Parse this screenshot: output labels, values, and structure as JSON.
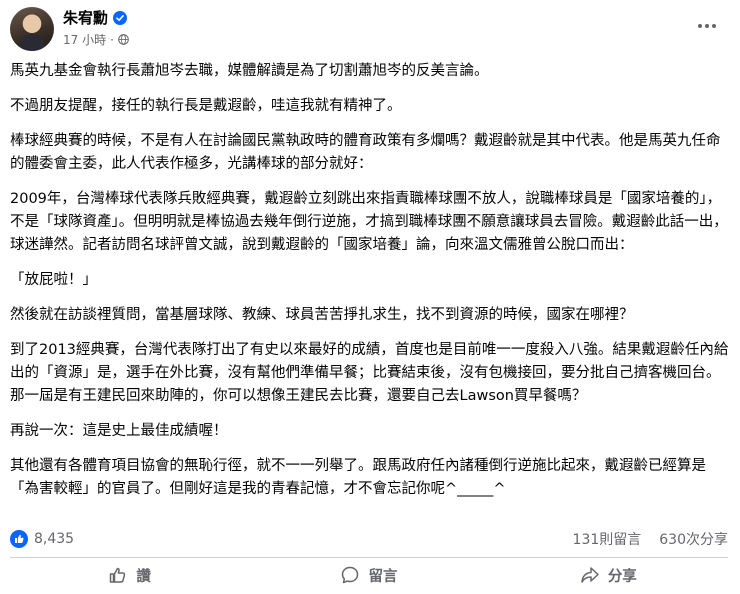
{
  "post": {
    "author": "朱宥勳",
    "time": "17 小時",
    "separator": "·",
    "paragraphs": [
      "馬英九基金會執行長蕭旭岑去職，媒體解讀是為了切割蕭旭岑的反美言論。",
      "不過朋友提醒，接任的執行長是戴遐齡，哇這我就有精神了。",
      "棒球經典賽的時候，不是有人在討論國民黨執政時的體育政策有多爛嗎？戴遐齡就是其中代表。他是馬英九任命的體委會主委，此人代表作極多，光講棒球的部分就好：",
      "2009年，台灣棒球代表隊兵敗經典賽，戴遐齡立刻跳出來指責職棒球團不放人，說職棒球員是「國家培養的」，不是「球隊資產」。但明明就是棒協過去幾年倒行逆施，才搞到職棒球團不願意讓球員去冒險。戴遐齡此話一出，球迷譁然。記者訪問名球評曾文誠，說到戴遐齡的「國家培養」論，向來溫文儒雅曾公脫口而出：",
      "「放屁啦！」",
      "然後就在訪談裡質問，當基層球隊、教練、球員苦苦掙扎求生，找不到資源的時候，國家在哪裡？",
      "到了2013經典賽，台灣代表隊打出了有史以來最好的成績，首度也是目前唯一一度殺入八強。結果戴遐齡任內給出的「資源」是，選手在外比賽，沒有幫他們準備早餐；比賽結束後，沒有包機接回，要分批自己擠客機回台。那一屆是有王建民回來助陣的，你可以想像王建民去比賽，還要自己去Lawson買早餐嗎？",
      "再說一次：這是史上最佳成績喔！",
      "其他還有各體育項目協會的無恥行徑，就不一一列舉了。跟馬政府任內諸種倒行逆施比起來，戴遐齡已經算是「為害較輕」的官員了。但剛好這是我的青春記憶，才不會忘記你呢^_____^"
    ]
  },
  "stats": {
    "reactions": "8,435",
    "comments": "131則留言",
    "shares": "630次分享"
  },
  "actions": {
    "like": "讚",
    "comment": "留言",
    "share": "分享"
  },
  "colors": {
    "brand_blue": "#0866ff",
    "secondary_text": "#65676b"
  },
  "icons": [
    "verified-badge-icon",
    "globe-icon",
    "more-options-icon",
    "like-reaction-icon",
    "thumbs-up-icon",
    "comment-bubble-icon",
    "share-arrow-icon"
  ]
}
